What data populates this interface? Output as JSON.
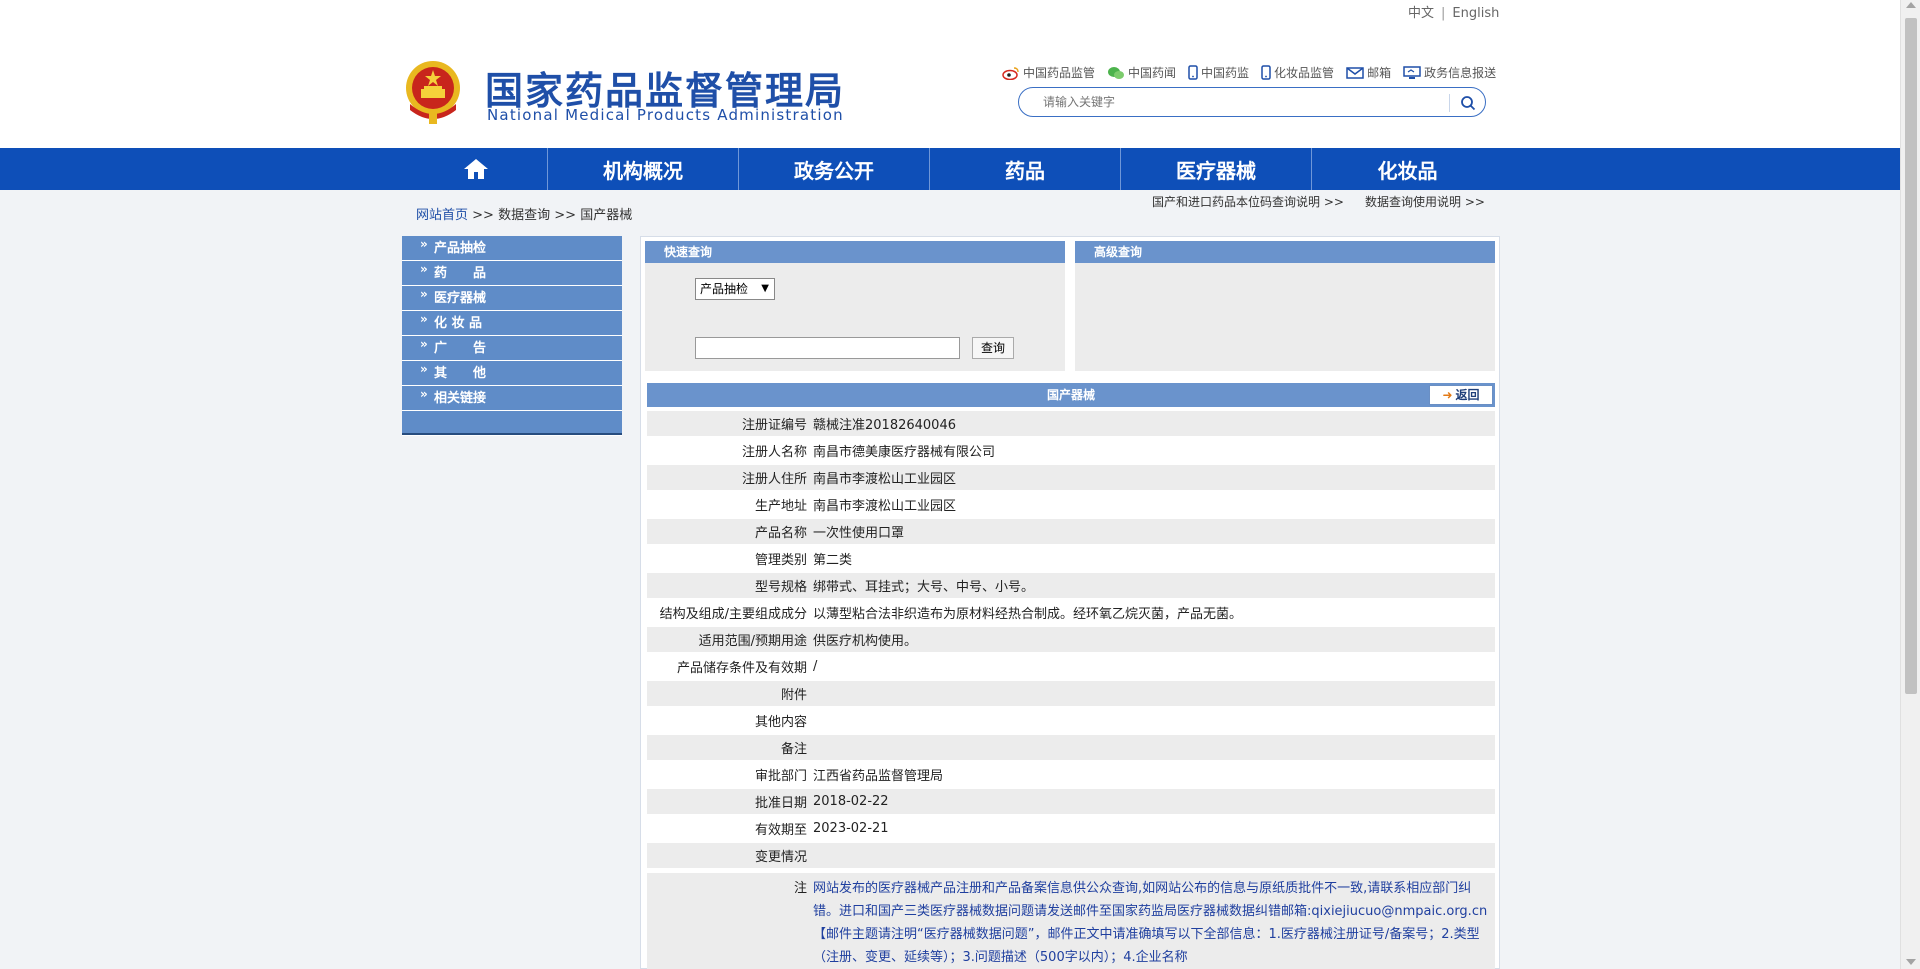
{
  "lang": {
    "zh": "中文",
    "en": "English",
    "sep": "|"
  },
  "site": {
    "name_cn": "国家药品监督管理局",
    "name_en": "National Medical Products Administration"
  },
  "quick_links": [
    {
      "label": "中国药品监管",
      "icon": "weibo-icon"
    },
    {
      "label": "中国药闻",
      "icon": "wechat-icon"
    },
    {
      "label": "中国药监",
      "icon": "mobile-icon"
    },
    {
      "label": "化妆品监管",
      "icon": "mobile-icon"
    },
    {
      "label": "邮箱",
      "icon": "mail-icon"
    },
    {
      "label": "政务信息报送",
      "icon": "monitor-icon"
    }
  ],
  "search": {
    "placeholder": "请输入关键字"
  },
  "nav": {
    "home_icon": "home-icon",
    "items": [
      "机构概况",
      "政务公开",
      "药品",
      "医疗器械",
      "化妆品"
    ]
  },
  "breadcrumb": {
    "home": "网站首页",
    "sep": ">>",
    "l2": "数据查询",
    "l3": "国产器械"
  },
  "top_notes": {
    "a": "国产和进口药品本位码查询说明 >>",
    "b": "数据查询使用说明 >>"
  },
  "sidebar": {
    "chevron": "»",
    "items": [
      "产品抽检",
      "药　　品",
      "医疗器械",
      "化 妆 品",
      "广　　告",
      "其　　他",
      "相关链接"
    ]
  },
  "quick_query": {
    "title": "快速查询",
    "select_value": "产品抽检",
    "button": "查询"
  },
  "advanced_query": {
    "title": "高级查询"
  },
  "detail": {
    "title": "国产器械",
    "back_label": "返回",
    "rows": [
      {
        "label": "注册证编号",
        "value": "赣械注准20182640046"
      },
      {
        "label": "注册人名称",
        "value": "南昌市德美康医疗器械有限公司"
      },
      {
        "label": "注册人住所",
        "value": "南昌市李渡松山工业园区"
      },
      {
        "label": "生产地址",
        "value": "南昌市李渡松山工业园区"
      },
      {
        "label": "产品名称",
        "value": "一次性使用口罩"
      },
      {
        "label": "管理类别",
        "value": "第二类"
      },
      {
        "label": "型号规格",
        "value": "绑带式、耳挂式；大号、中号、小号。"
      },
      {
        "label": "结构及组成/主要组成成分",
        "value": "以薄型粘合法非织造布为原材料经热合制成。经环氧乙烷灭菌，产品无菌。"
      },
      {
        "label": "适用范围/预期用途",
        "value": "供医疗机构使用。"
      },
      {
        "label": "产品储存条件及有效期",
        "value": "/"
      },
      {
        "label": "附件",
        "value": ""
      },
      {
        "label": "其他内容",
        "value": ""
      },
      {
        "label": "备注",
        "value": ""
      },
      {
        "label": "审批部门",
        "value": "江西省药品监督管理局"
      },
      {
        "label": "批准日期",
        "value": "2018-02-22"
      },
      {
        "label": "有效期至",
        "value": "2023-02-21"
      },
      {
        "label": "变更情况",
        "value": ""
      }
    ],
    "note_label": "注",
    "note_text": "网站发布的医疗器械产品注册和产品备案信息供公众查询,如网站公布的信息与原纸质批件不一致,请联系相应部门纠错。进口和国产三类医疗器械数据问题请发送邮件至国家药监局医疗器械数据纠错邮箱:qixiejiucuo@nmpaic.org.cn【邮件主题请注明“医疗器械数据问题”，邮件正文中请准确填写以下全部信息：1.医疗器械注册证号/备案号；2.类型（注册、变更、延续等）；3.问题描述（500字以内）；4.企业名称"
  },
  "colors": {
    "nav_blue": "#0e4fb8",
    "sidebar_blue": "#5f8cc8",
    "header_bar": "#6a93cc",
    "title_blue": "#1f4fa8"
  }
}
